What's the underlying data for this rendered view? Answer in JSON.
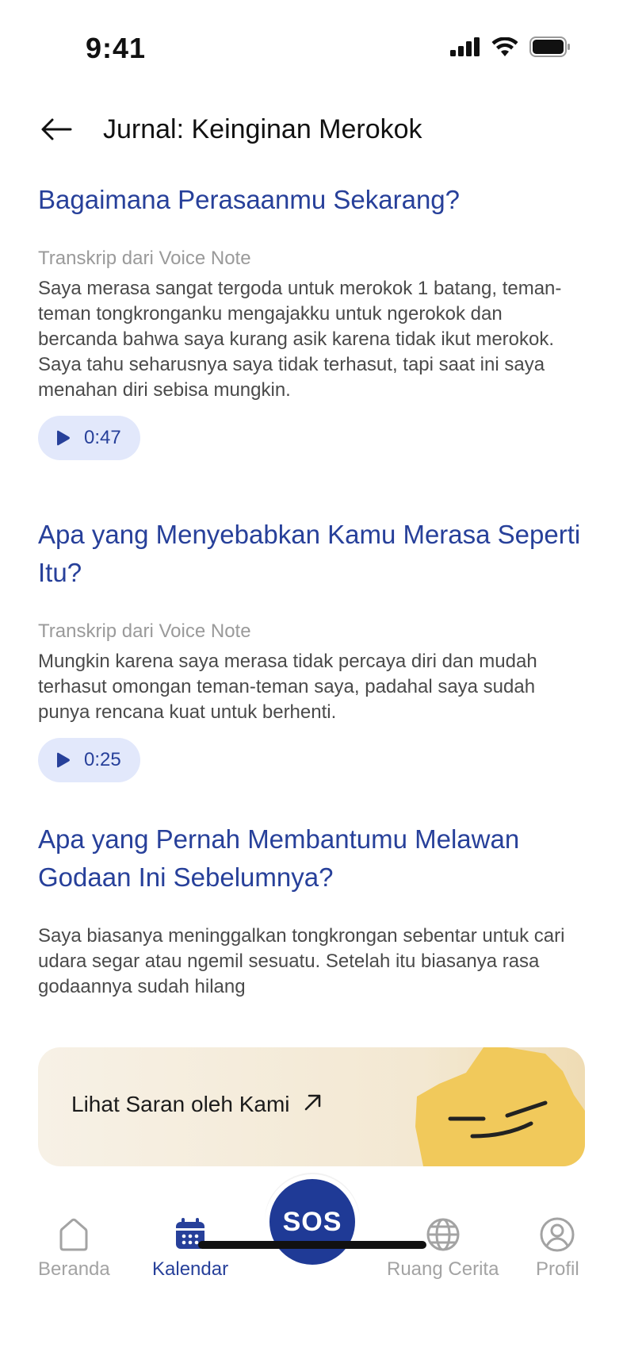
{
  "status_bar": {
    "time": "9:41"
  },
  "header": {
    "title": "Jurnal: Keinginan Merokok"
  },
  "sections": [
    {
      "question": "Bagaimana Perasaanmu Sekarang?",
      "transcript_label": "Transkrip dari Voice Note",
      "answer": "Saya merasa sangat tergoda untuk merokok 1 batang, teman-teman tongkronganku mengajakku untuk ngerokok dan bercanda bahwa saya kurang asik karena tidak ikut merokok. Saya tahu seharusnya saya tidak terhasut, tapi saat ini saya menahan diri sebisa mungkin.",
      "audio_duration": "0:47"
    },
    {
      "question": "Apa yang Menyebabkan Kamu Merasa Seperti Itu?",
      "transcript_label": "Transkrip dari Voice Note",
      "answer": "Mungkin karena saya merasa tidak percaya diri dan mudah terhasut omongan teman-teman saya, padahal saya sudah punya rencana kuat untuk berhenti.",
      "audio_duration": "0:25"
    },
    {
      "question": "Apa yang Pernah Membantumu Melawan Godaan Ini Sebelumnya?",
      "answer": "Saya biasanya meninggalkan tongkrongan sebentar untuk cari udara segar atau ngemil sesuatu. Setelah itu biasanya rasa godaannya sudah hilang"
    }
  ],
  "suggestion_card": {
    "label": "Lihat Saran oleh Kami",
    "icon": "arrow-up-right-icon"
  },
  "bottom_nav": {
    "items": [
      {
        "label": "Beranda",
        "icon": "home-icon",
        "active": false
      },
      {
        "label": "Kalendar",
        "icon": "calendar-icon",
        "active": true
      },
      {
        "label": "Ruang Cerita",
        "icon": "globe-icon",
        "active": false
      },
      {
        "label": "Profil",
        "icon": "profile-icon",
        "active": false
      }
    ],
    "sos_label": "SOS"
  },
  "colors": {
    "accent": "#27409a",
    "sos": "#1f3a96",
    "audio_pill": "#e2e8fb",
    "mascot": "#f0c95a"
  }
}
